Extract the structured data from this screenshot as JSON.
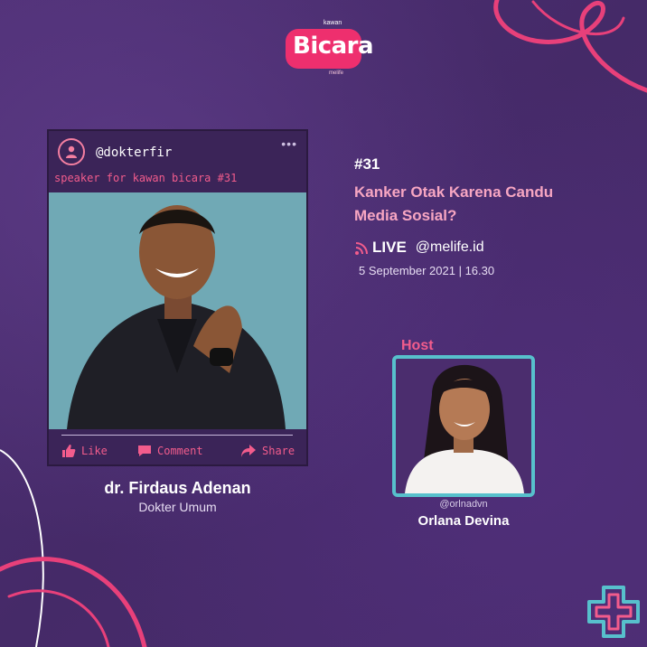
{
  "logo": {
    "brand": "Bicara",
    "top_word": "kawan",
    "bottom_word": "melife"
  },
  "post": {
    "handle": "@dokterfir",
    "menu_dots": "•••",
    "caption": "speaker for kawan bicara #31",
    "actions": {
      "like": "Like",
      "comment": "Comment",
      "share": "Share"
    }
  },
  "speaker": {
    "name": "dr. Firdaus Adenan",
    "role": "Dokter Umum"
  },
  "episode": {
    "number": "#31",
    "title_line1": "Kanker Otak Karena Candu",
    "title_line2": "Media Sosial?",
    "live_label": "LIVE",
    "account": "@melife.id",
    "datetime": "5 September 2021 | 16.30"
  },
  "host": {
    "label": "Host",
    "handle": "@orlnadvn",
    "name": "Orlana Devina"
  },
  "colors": {
    "background": "#4a2c6e",
    "accent_pink": "#f25c8c",
    "title_pink": "#f7a6c2",
    "teal": "#57c0cc",
    "brand_red": "#ee2f6e"
  },
  "icons": [
    "user-icon",
    "more-dots-icon",
    "thumbs-up-icon",
    "comment-icon",
    "share-icon",
    "broadcast-icon",
    "plus-logo-icon"
  ]
}
